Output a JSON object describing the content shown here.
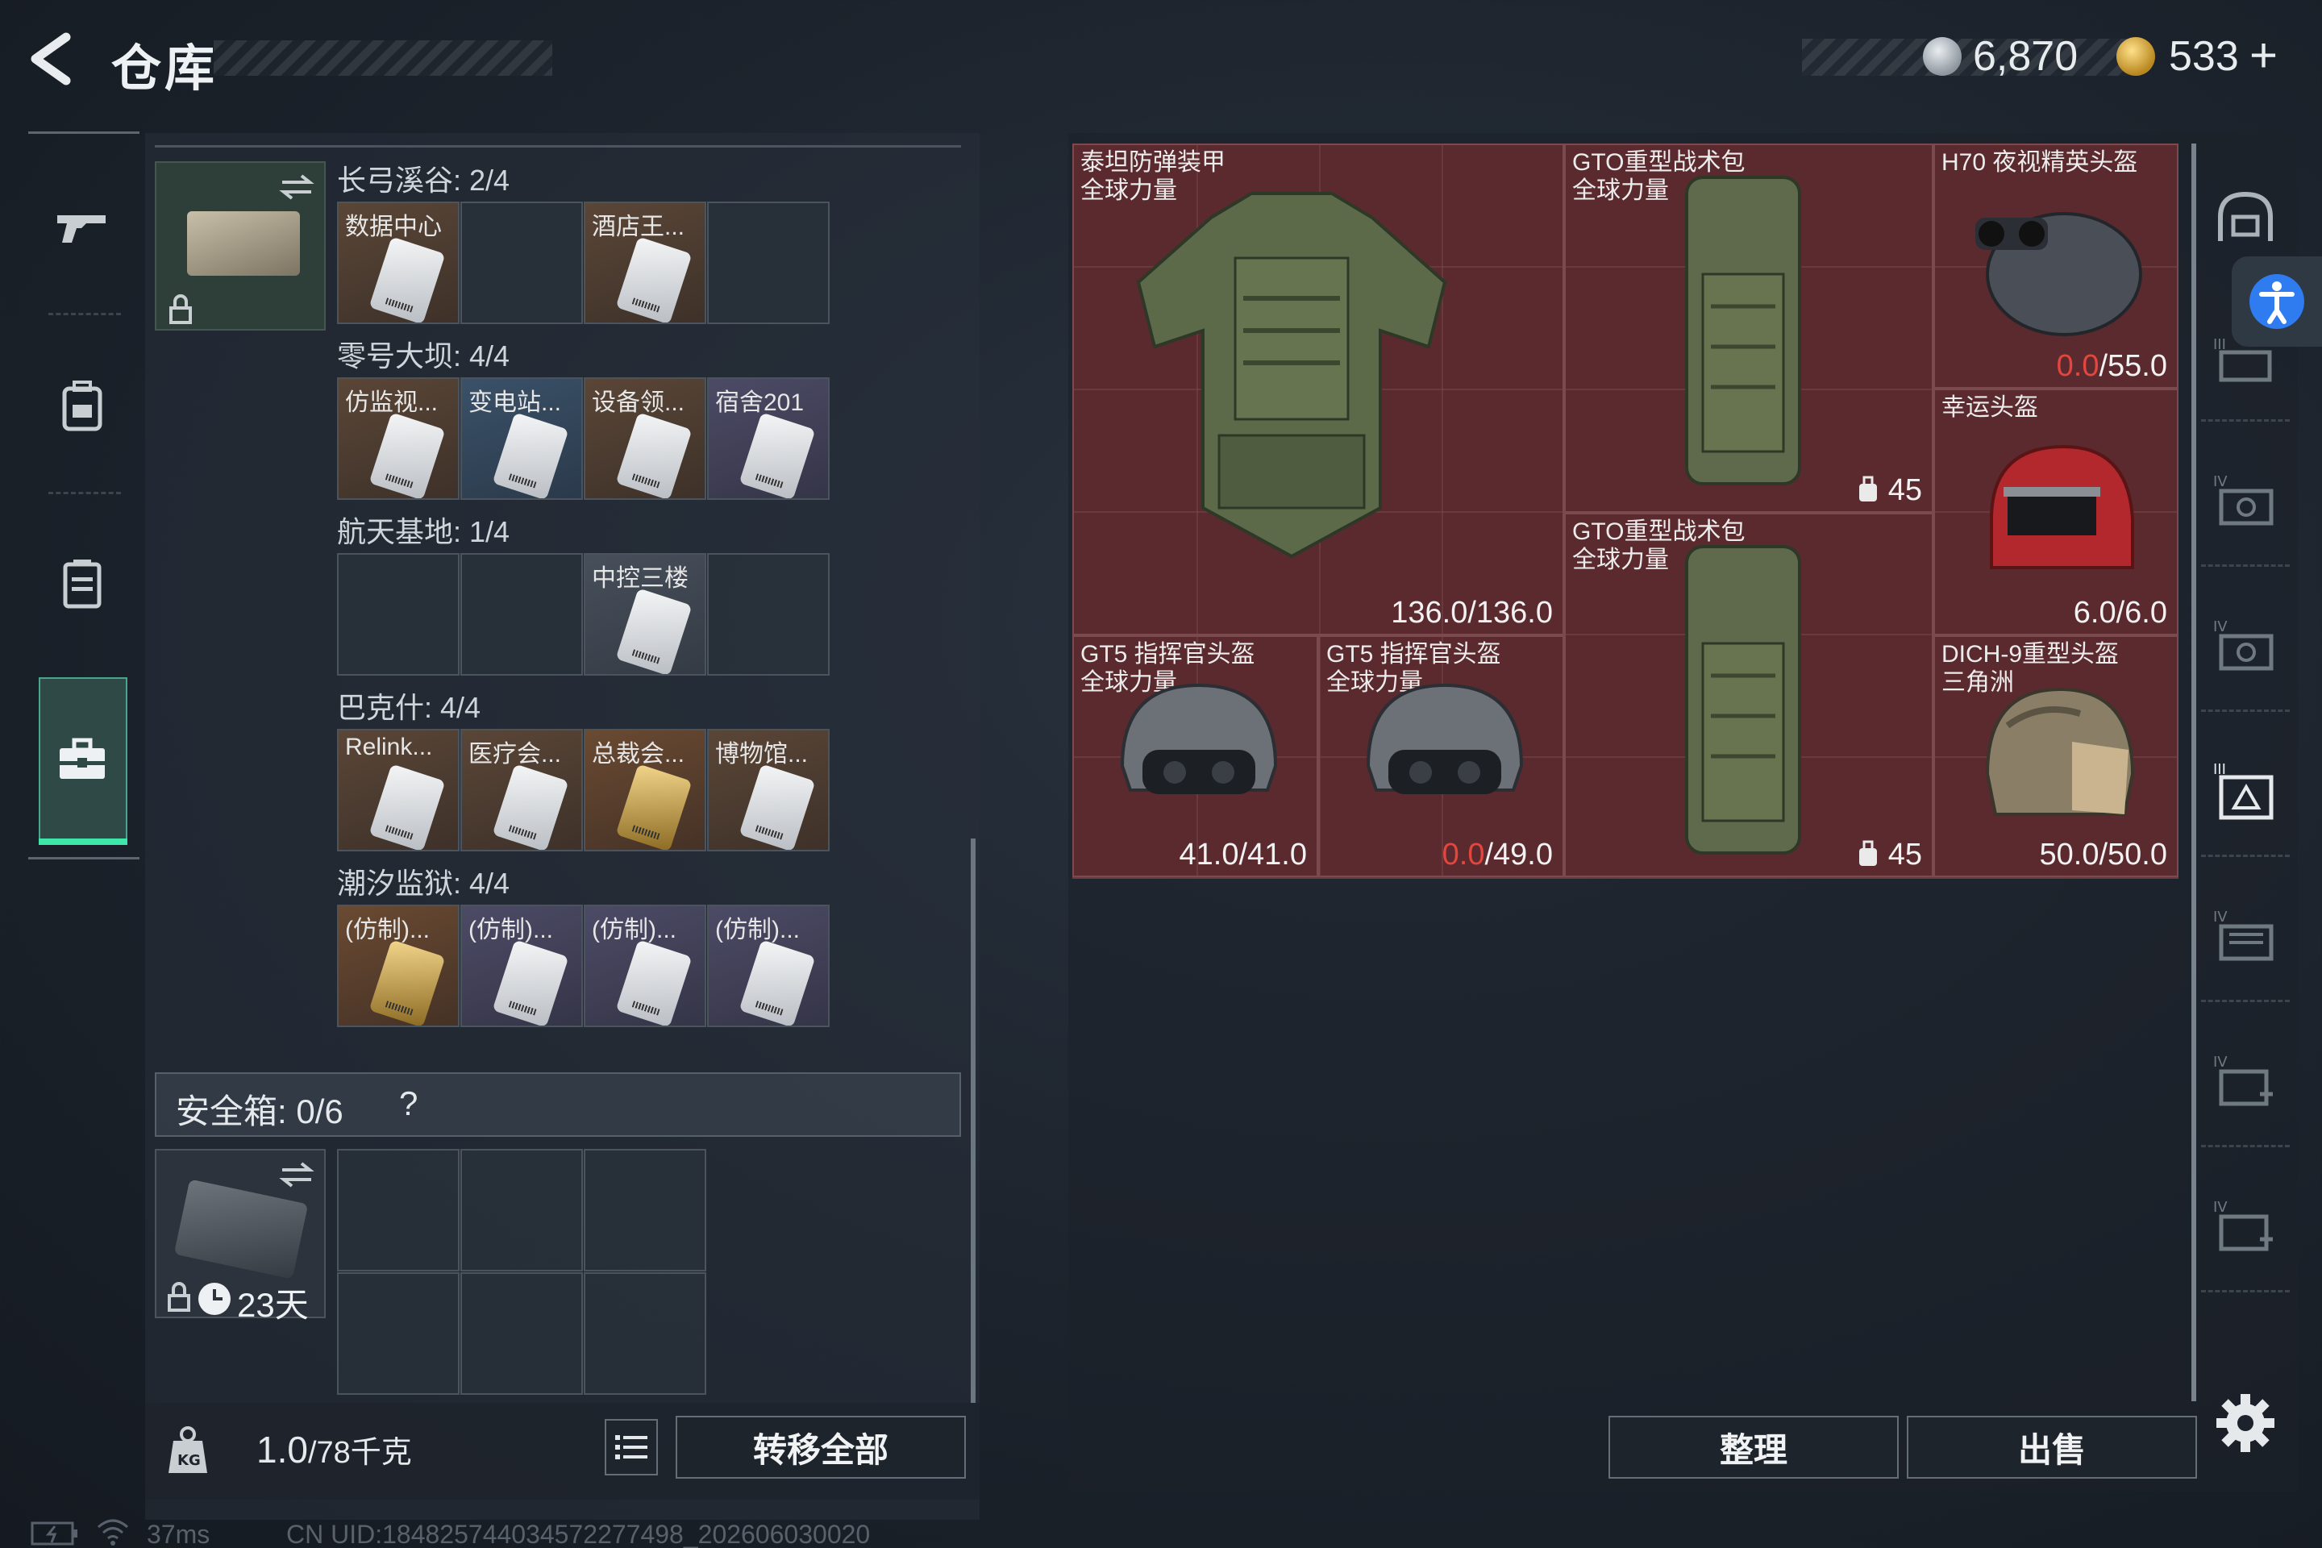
{
  "header": {
    "title": "仓库",
    "currency_silver": "6,870",
    "currency_gold": "533",
    "plus": "+"
  },
  "keycards": {
    "rows": [
      {
        "label": "长弓溪谷: 2/4",
        "slots": [
          {
            "name": "数据中心",
            "tone": "brown",
            "card": "white"
          },
          {
            "name": "",
            "tone": "empty",
            "card": ""
          },
          {
            "name": "酒店王...",
            "tone": "brown",
            "card": "white"
          },
          {
            "name": "",
            "tone": "empty",
            "card": ""
          }
        ]
      },
      {
        "label": "零号大坝: 4/4",
        "slots": [
          {
            "name": "仿监视...",
            "tone": "brown",
            "card": "white"
          },
          {
            "name": "变电站...",
            "tone": "blue",
            "card": "white"
          },
          {
            "name": "设备领...",
            "tone": "brown",
            "card": "white"
          },
          {
            "name": "宿舍201",
            "tone": "purple",
            "card": "white"
          }
        ]
      },
      {
        "label": "航天基地: 1/4",
        "slots": [
          {
            "name": "",
            "tone": "empty",
            "card": ""
          },
          {
            "name": "",
            "tone": "empty",
            "card": ""
          },
          {
            "name": "中控三楼",
            "tone": "gray",
            "card": "white"
          },
          {
            "name": "",
            "tone": "empty",
            "card": ""
          }
        ]
      },
      {
        "label": "巴克什: 4/4",
        "slots": [
          {
            "name": "Relink...",
            "tone": "brown",
            "card": "white"
          },
          {
            "name": "医疗会...",
            "tone": "brown",
            "card": "white"
          },
          {
            "name": "总裁会...",
            "tone": "gold",
            "card": "gold"
          },
          {
            "name": "博物馆...",
            "tone": "brown",
            "card": "white"
          }
        ]
      },
      {
        "label": "潮汐监狱: 4/4",
        "slots": [
          {
            "name": "(仿制)...",
            "tone": "gold",
            "card": "gold"
          },
          {
            "name": "(仿制)...",
            "tone": "purple",
            "card": "white"
          },
          {
            "name": "(仿制)...",
            "tone": "purple",
            "card": "white"
          },
          {
            "name": "(仿制)...",
            "tone": "purple",
            "card": "white"
          }
        ]
      }
    ]
  },
  "safebox": {
    "label": "安全箱: 0/6",
    "help": "?",
    "timer": "23天"
  },
  "bottom_left": {
    "weight_value": "1.0",
    "weight_max": "/78千克",
    "transfer_all": "转移全部"
  },
  "status": {
    "ping": "37ms",
    "uid": "CN UID:18482574403457227749​8_202606030020"
  },
  "items": {
    "armor": {
      "name1": "泰坦防弹装甲",
      "name2": "全球力量",
      "dur": "136.0/136.0"
    },
    "bag1": {
      "name1": "GTO重型战术包",
      "name2": "全球力量",
      "cap": "45"
    },
    "bag2": {
      "name1": "GTO重型战术包",
      "name2": "全球力量",
      "cap": "45"
    },
    "h70": {
      "name1": "H70 夜视精英头盔",
      "dur_cur": "0.0",
      "dur_max": "/55.0"
    },
    "lucky": {
      "name1": "幸运头盔",
      "dur": "6.0/6.0"
    },
    "gt5a": {
      "name1": "GT5 指挥官头盔",
      "name2": "全球力量",
      "dur": "41.0/41.0"
    },
    "gt5b": {
      "name1": "GT5 指挥官头盔",
      "name2": "全球力量",
      "dur_cur": "0.0",
      "dur_max": "/49.0"
    },
    "dich": {
      "name1": "DICH-9重型头盔",
      "name2": "三角洲",
      "dur": "50.0/50.0"
    }
  },
  "actions": {
    "sort": "整理",
    "sell": "出售"
  },
  "side_tabs": [
    "helmet-tab",
    "armor-tab",
    "rig-tab",
    "bag-tab",
    "safebox-tab",
    "container-tab",
    "medkit-tab",
    "medkit2-tab"
  ],
  "colors": {
    "accent_green": "#3ee6a9",
    "durability_low": "#e3463f",
    "item_bg": "#5a2a2e"
  }
}
